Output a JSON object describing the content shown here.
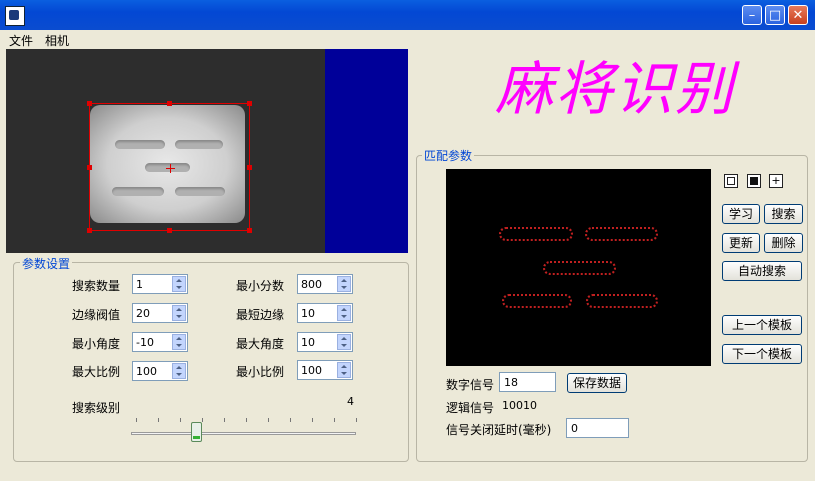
{
  "window": {
    "minimize_glyph": "–",
    "maximize_glyph": "□",
    "close_glyph": "✕"
  },
  "menu": [
    "文件",
    "相机"
  ],
  "title_art": "麻将识别",
  "params": {
    "group_label": "参数设置",
    "search_count": {
      "label": "搜索数量",
      "value": "1"
    },
    "edge_threshold": {
      "label": "边缘阀值",
      "value": "20"
    },
    "min_angle": {
      "label": "最小角度",
      "value": "-10"
    },
    "max_scale": {
      "label": "最大比例",
      "value": "100"
    },
    "min_score": {
      "label": "最小分数",
      "value": "800"
    },
    "min_edge": {
      "label": "最短边缘",
      "value": "10"
    },
    "max_angle": {
      "label": "最大角度",
      "value": "10"
    },
    "min_scale": {
      "label": "最小比例",
      "value": "100"
    },
    "search_level": {
      "label": "搜索级别",
      "value": "4",
      "fraction": 0.29
    }
  },
  "match": {
    "group_label": "匹配参数",
    "tools": [
      "",
      "",
      "+"
    ],
    "buttons": {
      "learn": "学习",
      "search": "搜索",
      "update": "更新",
      "delete": "删除",
      "auto_search": "自动搜索",
      "prev_template": "上一个模板",
      "next_template": "下一个模板",
      "save_data": "保存数据"
    },
    "digital_signal": {
      "label": "数字信号",
      "value": "18"
    },
    "logic_signal": {
      "label": "逻辑信号",
      "value": "10010"
    },
    "close_delay": {
      "label": "信号关闭延时(毫秒)",
      "value": "0"
    }
  },
  "colors": {
    "title_art": "#ff00ff",
    "roi": "#e00000",
    "group_label": "#0046d5",
    "camera_bg": "#2d2d2d",
    "camera_side": "#000099"
  }
}
